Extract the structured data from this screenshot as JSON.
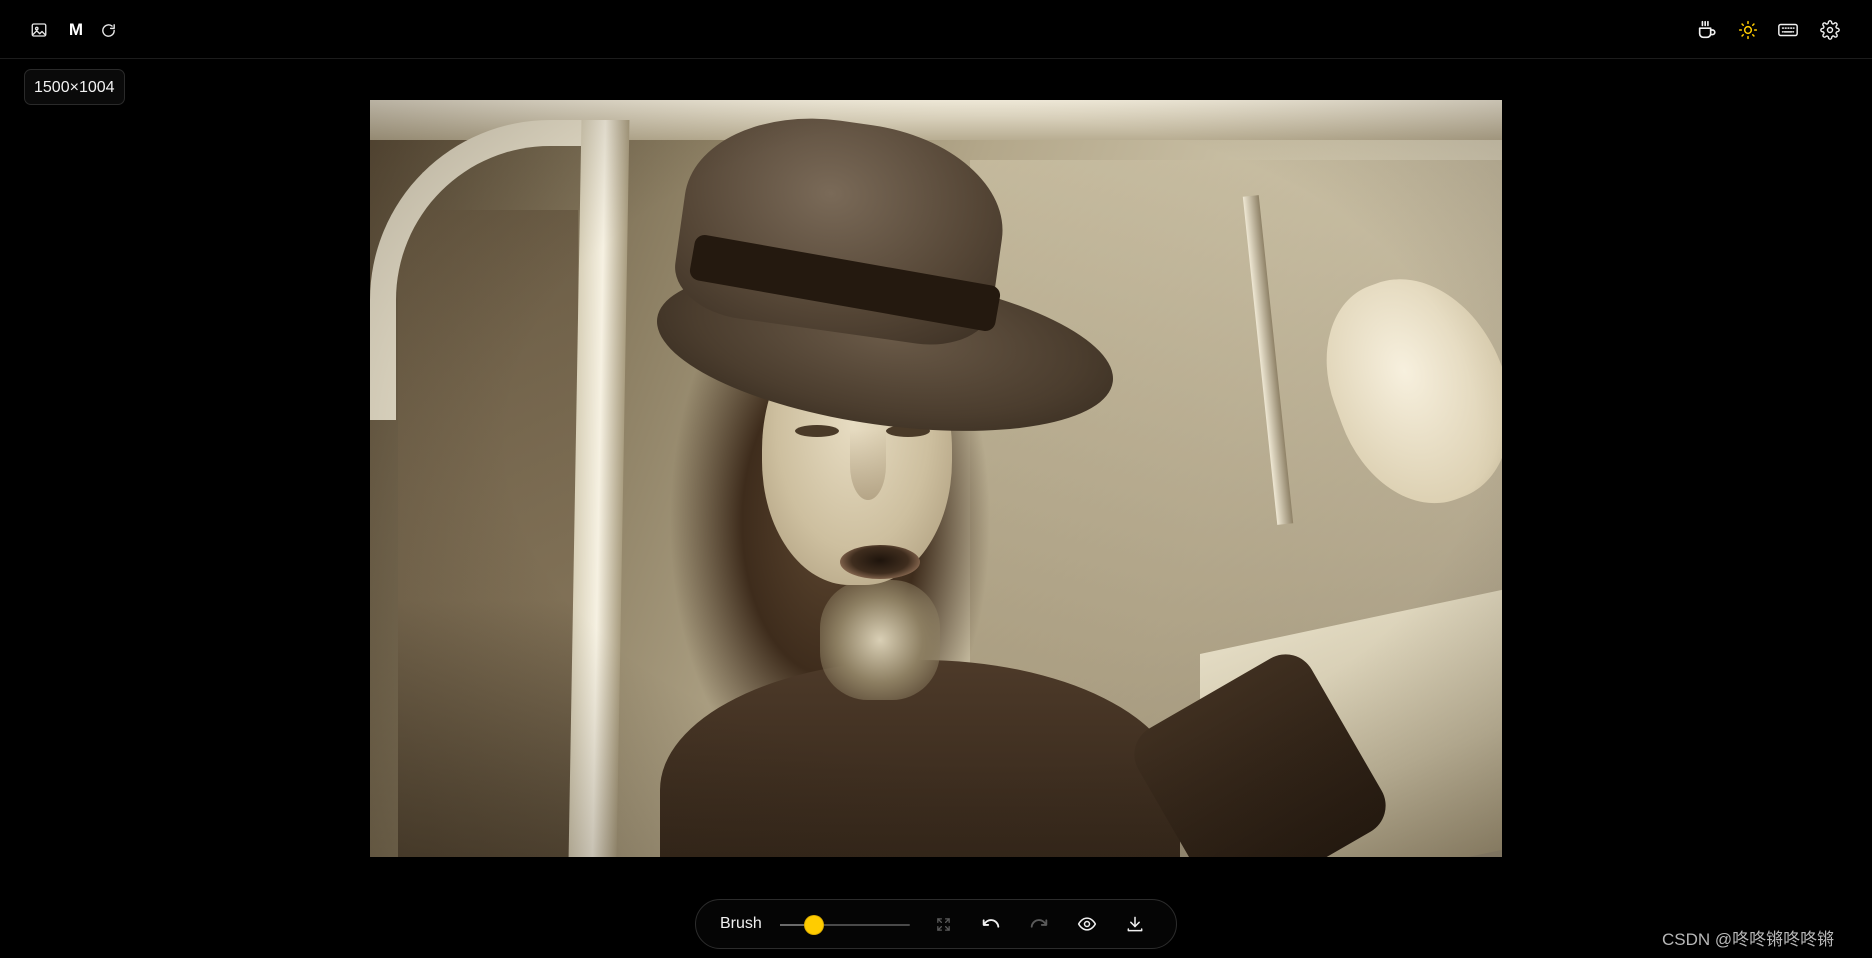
{
  "header": {
    "left": {
      "image_icon": "image-icon",
      "mask_label": "M",
      "reload_icon": "refresh-icon"
    },
    "right": {
      "coffee_icon": "coffee-icon",
      "theme_icon": "sun-icon",
      "keyboard_icon": "keyboard-icon",
      "settings_icon": "gear-icon"
    }
  },
  "image_info": {
    "size_label": "1500×1004"
  },
  "toolbar": {
    "brush_label": "Brush",
    "brush_size": {
      "value_fraction": 0.26
    },
    "buttons": [
      "fullscreen-icon",
      "undo-icon",
      "redo-icon",
      "eye-icon",
      "download-icon"
    ]
  },
  "watermark": {
    "text": "CSDN @咚咚锵咚咚锵"
  },
  "colors": {
    "background": "#000000",
    "accent": "#ffcc00",
    "text": "#ffffff",
    "muted_icon": "#5a5a5a"
  }
}
